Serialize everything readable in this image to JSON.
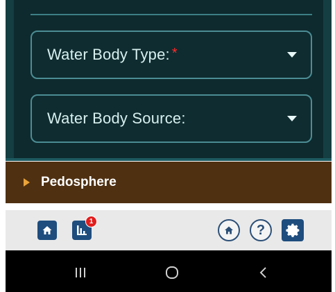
{
  "form": {
    "fields": [
      {
        "label": "Water Body Type:",
        "required_mark": "*"
      },
      {
        "label": "Water Body Source:"
      }
    ]
  },
  "section": {
    "title": "Pedosphere",
    "expander_icon": "triangle-right-icon"
  },
  "toolbar": {
    "home_icon": "home-icon",
    "stats_icon": "bar-chart-icon",
    "stats_badge": "1",
    "home2_icon": "home-circle-icon",
    "help_label": "?",
    "settings_icon": "gear-icon"
  },
  "navbar": {
    "recents_icon": "recents-icon",
    "home_icon": "home-circle-outline-icon",
    "back_icon": "back-chevron-icon"
  },
  "colors": {
    "panel": "#0e2a2e",
    "field_border": "#4c8d94",
    "required": "#ff2b2b",
    "section_bar": "#4f3011",
    "section_arrow": "#e9a33a",
    "toolbar_blue": "#1e4d7e"
  }
}
